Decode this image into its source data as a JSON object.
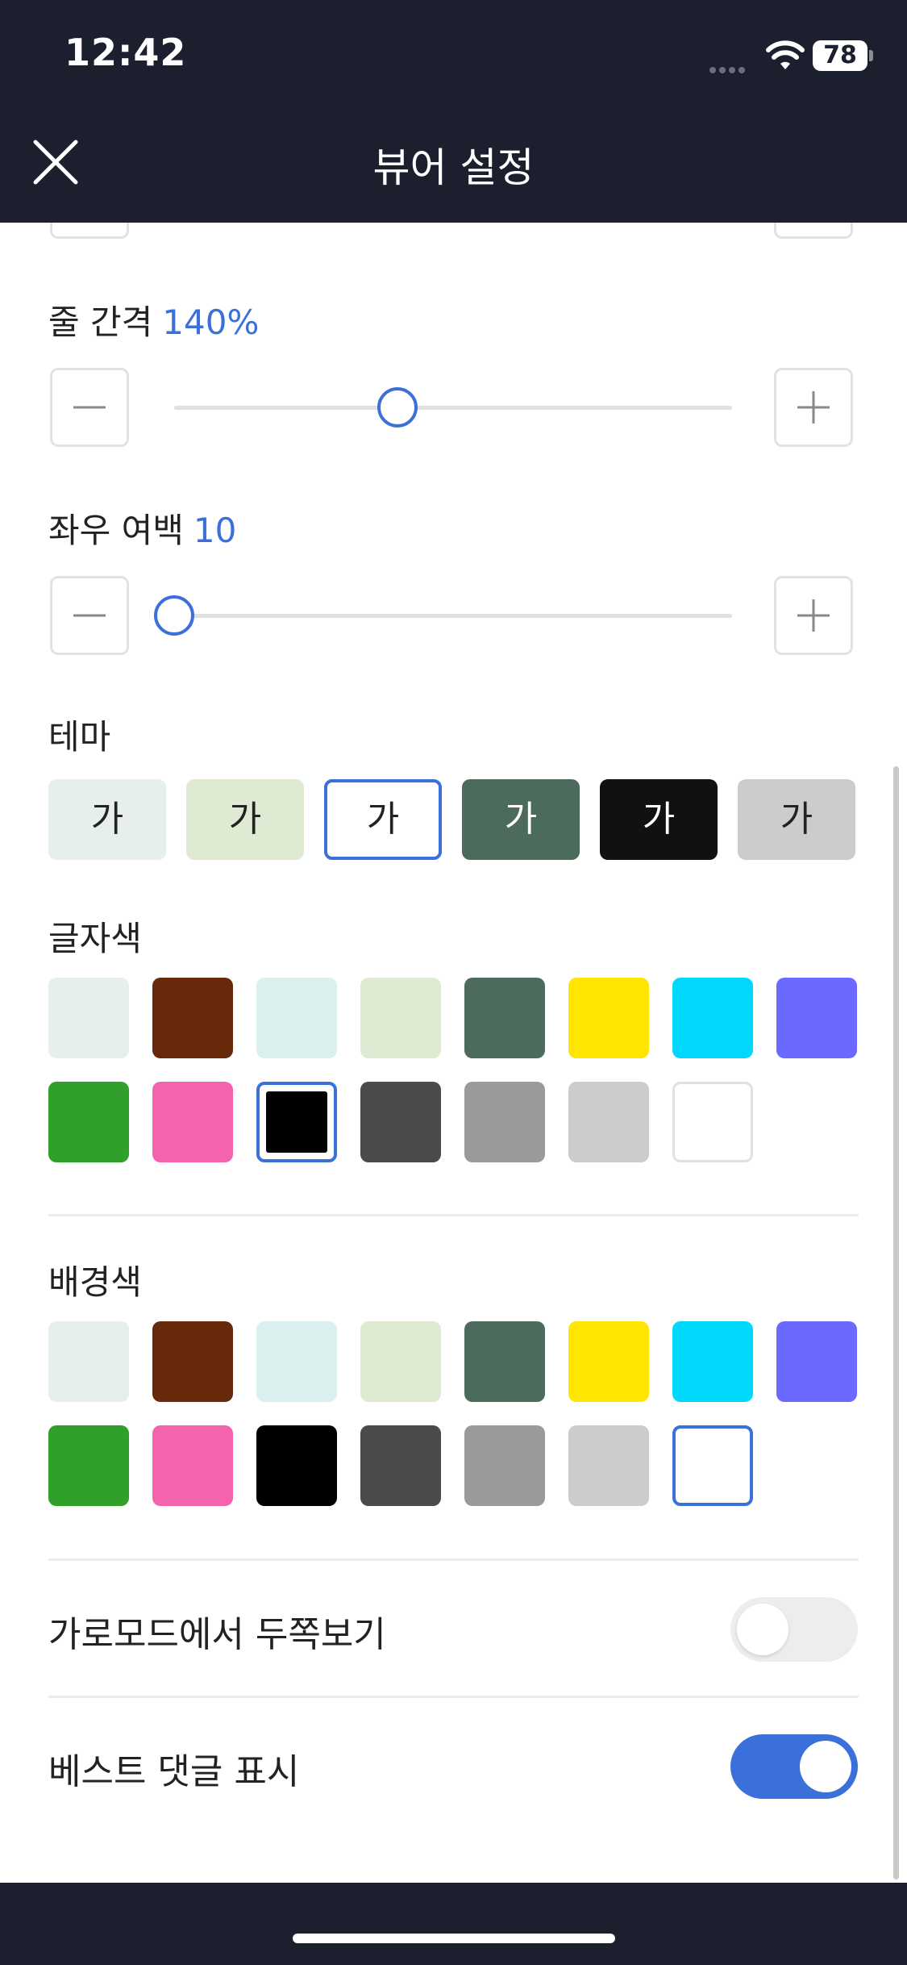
{
  "status_bar": {
    "time": "12:42",
    "battery": "78"
  },
  "nav": {
    "title": "뷰어 설정",
    "close_icon": "close-icon"
  },
  "line_spacing": {
    "label": "줄 간격",
    "value": "140%",
    "slider_fraction": 0.4
  },
  "side_margin": {
    "label": "좌우 여백",
    "value": "10",
    "slider_fraction": 0.0
  },
  "theme": {
    "label": "테마",
    "glyph": "가",
    "options": [
      {
        "bg": "#e6eeee",
        "fg": "#222222"
      },
      {
        "bg": "#dfead3",
        "fg": "#222222"
      },
      {
        "bg": "#ffffff",
        "fg": "#222222",
        "selected": true
      },
      {
        "bg": "#4d6b5c",
        "fg": "#ffffff"
      },
      {
        "bg": "#111111",
        "fg": "#ffffff"
      },
      {
        "bg": "#cccccc",
        "fg": "#222222"
      }
    ]
  },
  "text_color": {
    "label": "글자색",
    "colors": [
      "#e6eeee",
      "#67290a",
      "#dcefef",
      "#dfead3",
      "#4d6b5c",
      "#ffe500",
      "#00d7ff",
      "#6b69ff",
      "#30a02b",
      "#f464ac",
      "#000000",
      "#4a4a4a",
      "#9a9a98",
      "#cccccc",
      "#ffffff"
    ],
    "selected_index": 10
  },
  "bg_color": {
    "label": "배경색",
    "colors": [
      "#e6eeee",
      "#67290a",
      "#dcefef",
      "#dfead3",
      "#4d6b5c",
      "#ffe500",
      "#00d7ff",
      "#6b69ff",
      "#30a02b",
      "#f464ac",
      "#000000",
      "#4a4a4a",
      "#9a9a98",
      "#cccccc",
      "#ffffff"
    ],
    "selected_index": 14
  },
  "landscape_dual": {
    "label": "가로모드에서 두쪽보기",
    "enabled": false
  },
  "best_comments": {
    "label": "베스트 댓글 표시",
    "enabled": true
  },
  "colors": {
    "accent": "#3b6fd9",
    "toggle_off": "#ededed",
    "bar": "#1b1f2e"
  }
}
